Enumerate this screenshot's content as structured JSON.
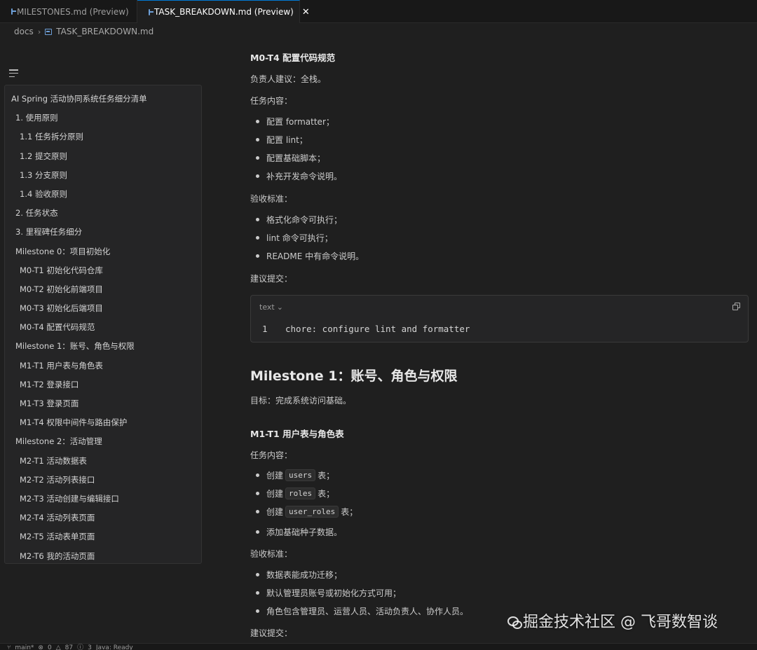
{
  "tabs": [
    {
      "label": "MILESTONES.md (Preview)",
      "active": false
    },
    {
      "label": "TASK_BREAKDOWN.md (Preview)",
      "active": true
    }
  ],
  "breadcrumb": {
    "folder": "docs",
    "file": "TASK_BREAKDOWN.md"
  },
  "toc": {
    "items": [
      {
        "label": "AI Spring 活动协同系统任务细分清单",
        "level": 1
      },
      {
        "label": "1. 使用原则",
        "level": 2
      },
      {
        "label": "1.1 任务拆分原则",
        "level": 3
      },
      {
        "label": "1.2 提交原则",
        "level": 3
      },
      {
        "label": "1.3 分支原则",
        "level": 3
      },
      {
        "label": "1.4 验收原则",
        "level": 3
      },
      {
        "label": "2. 任务状态",
        "level": 2
      },
      {
        "label": "3. 里程碑任务细分",
        "level": 2
      },
      {
        "label": "Milestone 0：项目初始化",
        "level": 2
      },
      {
        "label": "M0-T1 初始化代码仓库",
        "level": 3
      },
      {
        "label": "M0-T2 初始化前端项目",
        "level": 3
      },
      {
        "label": "M0-T3 初始化后端项目",
        "level": 3
      },
      {
        "label": "M0-T4 配置代码规范",
        "level": 3
      },
      {
        "label": "Milestone 1：账号、角色与权限",
        "level": 2
      },
      {
        "label": "M1-T1 用户表与角色表",
        "level": 3
      },
      {
        "label": "M1-T2 登录接口",
        "level": 3
      },
      {
        "label": "M1-T3 登录页面",
        "level": 3
      },
      {
        "label": "M1-T4 权限中间件与路由保护",
        "level": 3
      },
      {
        "label": "Milestone 2：活动管理",
        "level": 2
      },
      {
        "label": "M2-T1 活动数据表",
        "level": 3
      },
      {
        "label": "M2-T2 活动列表接口",
        "level": 3
      },
      {
        "label": "M2-T3 活动创建与编辑接口",
        "level": 3
      },
      {
        "label": "M2-T4 活动列表页面",
        "level": 3
      },
      {
        "label": "M2-T5 活动表单页面",
        "level": 3
      },
      {
        "label": "M2-T6 我的活动页面",
        "level": 3
      }
    ]
  },
  "content": {
    "m0t4_heading": "M0-T4 配置代码规范",
    "m0t4_owner": "负责人建议：全栈。",
    "task_label_1": "任务内容：",
    "m0t4_tasks": [
      "配置 formatter；",
      "配置 lint；",
      "配置基础脚本；",
      "补充开发命令说明。"
    ],
    "accept_label_1": "验收标准：",
    "m0t4_accept": [
      "格式化命令可执行；",
      "lint 命令可执行；",
      "README 中有命令说明。"
    ],
    "commit_label_1": "建议提交：",
    "code": {
      "lang": "text",
      "line_number": "1",
      "text": "chore: configure lint and formatter"
    },
    "milestone1_heading": "Milestone 1：账号、角色与权限",
    "milestone1_goal": "目标：完成系统访问基础。",
    "m1t1_heading": "M1-T1 用户表与角色表",
    "task_label_2": "任务内容：",
    "m1t1_tasks": [
      {
        "prefix": "创建",
        "code": "users",
        "suffix": "表；"
      },
      {
        "prefix": "创建",
        "code": "roles",
        "suffix": "表；"
      },
      {
        "prefix": "创建",
        "code": "user_roles",
        "suffix": "表；"
      },
      {
        "prefix": "添加基础种子数据。",
        "code": "",
        "suffix": ""
      }
    ],
    "accept_label_2": "验收标准：",
    "m1t1_accept": [
      "数据表能成功迁移；",
      "默认管理员账号或初始化方式可用；",
      "角色包含管理员、运营人员、活动负责人、协作人员。"
    ],
    "commit_label_2": "建议提交："
  },
  "watermark": "掘金技术社区 @ 飞哥数智谈",
  "statusbar": {
    "branch": "main*",
    "errors": "0",
    "warnings": "87",
    "info": "3",
    "java": "Java: Ready"
  },
  "colors": {
    "accent": "#0078d4",
    "background": "#1f1f1f",
    "panel": "#252526"
  }
}
